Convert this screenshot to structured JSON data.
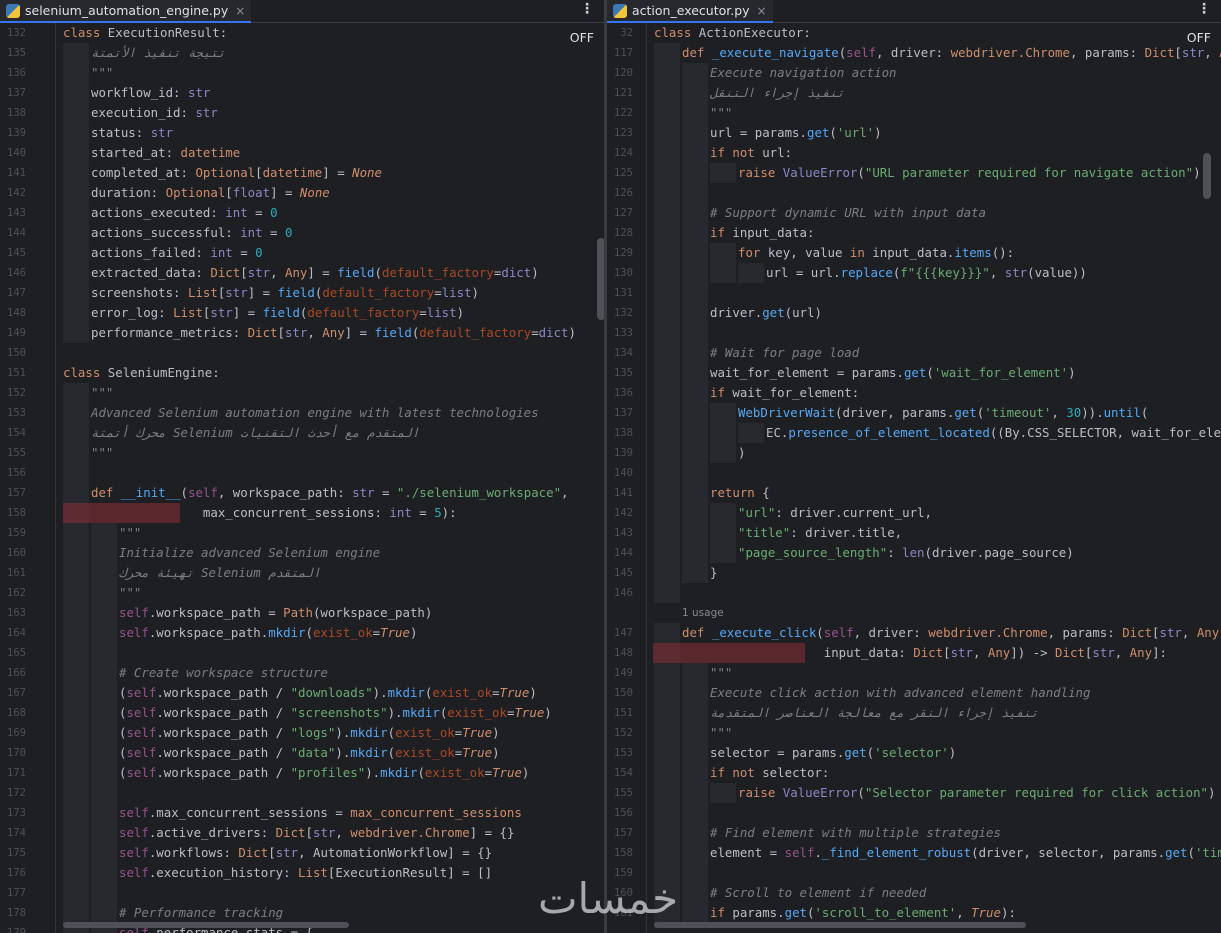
{
  "left": {
    "tab_label": "selenium_automation_engine.py",
    "tab_close": "×",
    "menu_glyph": "⋮",
    "status": "OFF",
    "lines": [
      {
        "n": "132",
        "html": "<span class='k'>class</span> <span class='cl'>ExecutionResult</span>:",
        "indent": 0
      },
      {
        "n": "135",
        "html": "<span class='c'>تتيجة تنفيذ الأتمتة</span>",
        "indent": 1
      },
      {
        "n": "136",
        "html": "<span class='c'>\"\"\"</span>",
        "indent": 1
      },
      {
        "n": "137",
        "html": "workflow_id: <span class='b'>str</span>",
        "indent": 1
      },
      {
        "n": "138",
        "html": "execution_id: <span class='b'>str</span>",
        "indent": 1
      },
      {
        "n": "139",
        "html": "status: <span class='b'>str</span>",
        "indent": 1
      },
      {
        "n": "140",
        "html": "started_at: <span class='bi'>datetime</span>",
        "indent": 1
      },
      {
        "n": "141",
        "html": "completed_at: <span class='bi'>Optional</span>[<span class='bi'>datetime</span>] = <span class='kw'>None</span>",
        "indent": 1
      },
      {
        "n": "142",
        "html": "duration: <span class='bi'>Optional</span>[<span class='b'>float</span>] = <span class='kw'>None</span>",
        "indent": 1
      },
      {
        "n": "143",
        "html": "actions_executed: <span class='b'>int</span> = <span class='n'>0</span>",
        "indent": 1
      },
      {
        "n": "144",
        "html": "actions_successful: <span class='b'>int</span> = <span class='n'>0</span>",
        "indent": 1
      },
      {
        "n": "145",
        "html": "actions_failed: <span class='b'>int</span> = <span class='n'>0</span>",
        "indent": 1
      },
      {
        "n": "146",
        "html": "extracted_data: <span class='bi'>Dict</span>[<span class='b'>str</span>, <span class='bi'>Any</span>] = <span class='f'>field</span>(<span class='p'>default_factory</span>=<span class='b'>dict</span>)",
        "indent": 1
      },
      {
        "n": "147",
        "html": "screenshots: <span class='bi'>List</span>[<span class='b'>str</span>] = <span class='f'>field</span>(<span class='p'>default_factory</span>=<span class='b'>list</span>)",
        "indent": 1
      },
      {
        "n": "148",
        "html": "error_log: <span class='bi'>List</span>[<span class='b'>str</span>] = <span class='f'>field</span>(<span class='p'>default_factory</span>=<span class='b'>list</span>)",
        "indent": 1
      },
      {
        "n": "149",
        "html": "performance_metrics: <span class='bi'>Dict</span>[<span class='b'>str</span>, <span class='bi'>Any</span>] = <span class='f'>field</span>(<span class='p'>default_factory</span>=<span class='b'>dict</span>)",
        "indent": 1
      },
      {
        "n": "150",
        "html": "",
        "indent": 0
      },
      {
        "n": "151",
        "html": "<span class='k'>class</span> <span class='cl'>SeleniumEngine</span>:",
        "indent": 0
      },
      {
        "n": "152",
        "html": "<span class='c'>\"\"\"</span>",
        "indent": 1
      },
      {
        "n": "153",
        "html": "<span class='c'>Advanced Selenium automation engine with latest technologies</span>",
        "indent": 1
      },
      {
        "n": "154",
        "html": "<span class='c'>محرك أتمتة Selenium المتقدم مع أحدث التقنيات</span>",
        "indent": 1
      },
      {
        "n": "155",
        "html": "<span class='c'>\"\"\"</span>",
        "indent": 1
      },
      {
        "n": "156",
        "html": "",
        "indent": 1
      },
      {
        "n": "157",
        "html": "<span class='k'>def</span> <span class='f'>__init__</span>(<span class='sf'>self</span>, workspace_path: <span class='b'>str</span> = <span class='s'>\"./selenium_workspace\"</span>,",
        "indent": 1
      },
      {
        "n": "158",
        "html": "               max_concurrent_sessions: <span class='b'>int</span> = <span class='n'>5</span>):",
        "indent": 1,
        "hl": [
          63,
          180
        ]
      },
      {
        "n": "159",
        "html": "<span class='c'>\"\"\"</span>",
        "indent": 2
      },
      {
        "n": "160",
        "html": "<span class='c'>Initialize advanced Selenium engine</span>",
        "indent": 2
      },
      {
        "n": "161",
        "html": "<span class='c'>تهيئة محرك Selenium المتقدم</span>",
        "indent": 2
      },
      {
        "n": "162",
        "html": "<span class='c'>\"\"\"</span>",
        "indent": 2
      },
      {
        "n": "163",
        "html": "<span class='sf'>self</span>.workspace_path = <span class='bi'>Path</span>(workspace_path)",
        "indent": 2
      },
      {
        "n": "164",
        "html": "<span class='sf'>self</span>.workspace_path.<span class='f'>mkdir</span>(<span class='p'>exist_ok</span>=<span class='kw'>True</span>)",
        "indent": 2
      },
      {
        "n": "165",
        "html": "",
        "indent": 2
      },
      {
        "n": "166",
        "html": "<span class='c'># Create workspace structure</span>",
        "indent": 2
      },
      {
        "n": "167",
        "html": "(<span class='sf'>self</span>.workspace_path / <span class='s'>\"downloads\"</span>).<span class='f'>mkdir</span>(<span class='p'>exist_ok</span>=<span class='kw'>True</span>)",
        "indent": 2
      },
      {
        "n": "168",
        "html": "(<span class='sf'>self</span>.workspace_path / <span class='s'>\"screenshots\"</span>).<span class='f'>mkdir</span>(<span class='p'>exist_ok</span>=<span class='kw'>True</span>)",
        "indent": 2
      },
      {
        "n": "169",
        "html": "(<span class='sf'>self</span>.workspace_path / <span class='s'>\"logs\"</span>).<span class='f'>mkdir</span>(<span class='p'>exist_ok</span>=<span class='kw'>True</span>)",
        "indent": 2
      },
      {
        "n": "170",
        "html": "(<span class='sf'>self</span>.workspace_path / <span class='s'>\"data\"</span>).<span class='f'>mkdir</span>(<span class='p'>exist_ok</span>=<span class='kw'>True</span>)",
        "indent": 2
      },
      {
        "n": "171",
        "html": "(<span class='sf'>self</span>.workspace_path / <span class='s'>\"profiles\"</span>).<span class='f'>mkdir</span>(<span class='p'>exist_ok</span>=<span class='kw'>True</span>)",
        "indent": 2
      },
      {
        "n": "172",
        "html": "",
        "indent": 2
      },
      {
        "n": "173",
        "html": "<span class='sf'>self</span>.max_concurrent_sessions = <span class='bi'>max_concurrent_sessions</span>",
        "indent": 2
      },
      {
        "n": "174",
        "html": "<span class='sf'>self</span>.active_drivers: <span class='bi'>Dict</span>[<span class='b'>str</span>, <span class='bi'>webdriver.Chrome</span>] = {}",
        "indent": 2
      },
      {
        "n": "175",
        "html": "<span class='sf'>self</span>.workflows: <span class='bi'>Dict</span>[<span class='b'>str</span>, <span class='cl'>AutomationWorkflow</span>] = {}",
        "indent": 2
      },
      {
        "n": "176",
        "html": "<span class='sf'>self</span>.execution_history: <span class='bi'>List</span>[<span class='cl'>ExecutionResult</span>] = []",
        "indent": 2
      },
      {
        "n": "177",
        "html": "",
        "indent": 2
      },
      {
        "n": "178",
        "html": "<span class='c'># Performance tracking</span>",
        "indent": 2
      },
      {
        "n": "179",
        "html": "<span class='sf'>self</span>.performance_stats = {",
        "indent": 2
      }
    ]
  },
  "right": {
    "tab_label": "action_executor.py",
    "tab_close": "×",
    "menu_glyph": "⋮",
    "status": "OFF",
    "usage_label": "1 usage",
    "lines": [
      {
        "n": "32",
        "html": "<span class='k'>class</span> <span class='cl'>ActionExecutor</span>:",
        "indent": 0
      },
      {
        "n": "117",
        "html": "<span class='k'>def</span> <span class='f'>_execute_navigate</span>(<span class='sf'>self</span>, driver: <span class='bi'>webdriver.Chrome</span>, params: <span class='bi'>Dict</span>[<span class='b'>str</span>, <span class='bi'>Any</span>]",
        "indent": 1
      },
      {
        "n": "120",
        "html": "<span class='c'>Execute navigation action</span>",
        "indent": 2
      },
      {
        "n": "121",
        "html": "<span class='c'>تنفيذ إجراء التنقل</span>",
        "indent": 2
      },
      {
        "n": "122",
        "html": "<span class='c'>\"\"\"</span>",
        "indent": 2
      },
      {
        "n": "123",
        "html": "url = params.<span class='f'>get</span>(<span class='s'>'url'</span>)",
        "indent": 2
      },
      {
        "n": "124",
        "html": "<span class='k'>if not</span> url:",
        "indent": 2
      },
      {
        "n": "125",
        "html": "<span class='k'>raise</span> <span class='b'>ValueError</span>(<span class='s'>\"URL parameter required for navigate action\"</span>)",
        "indent": 3
      },
      {
        "n": "126",
        "html": "",
        "indent": 2
      },
      {
        "n": "127",
        "html": "<span class='c'># Support dynamic URL with input data</span>",
        "indent": 2
      },
      {
        "n": "128",
        "html": "<span class='k'>if</span> input_data:",
        "indent": 2
      },
      {
        "n": "129",
        "html": "<span class='k'>for</span> key, value <span class='k'>in</span> input_data.<span class='f'>items</span>():",
        "indent": 3
      },
      {
        "n": "130",
        "html": "url = url.<span class='f'>replace</span>(<span class='s'>f\"{{{key}}}\"</span>, <span class='b'>str</span>(value))",
        "indent": 4
      },
      {
        "n": "131",
        "html": "",
        "indent": 2
      },
      {
        "n": "132",
        "html": "driver.<span class='f'>get</span>(url)",
        "indent": 2
      },
      {
        "n": "133",
        "html": "",
        "indent": 2
      },
      {
        "n": "134",
        "html": "<span class='c'># Wait for page load</span>",
        "indent": 2
      },
      {
        "n": "135",
        "html": "wait_for_element = params.<span class='f'>get</span>(<span class='s'>'wait_for_element'</span>)",
        "indent": 2
      },
      {
        "n": "136",
        "html": "<span class='k'>if</span> wait_for_element:",
        "indent": 2
      },
      {
        "n": "137",
        "html": "<span class='f'>WebDriverWait</span>(driver, params.<span class='f'>get</span>(<span class='s'>'timeout'</span>, <span class='n'>30</span>)).<span class='f'>until</span>(",
        "indent": 3
      },
      {
        "n": "138",
        "html": "EC.<span class='f'>presence_of_element_located</span>((By.CSS_SELECTOR, wait_for_elemen",
        "indent": 4
      },
      {
        "n": "139",
        "html": ")",
        "indent": 3
      },
      {
        "n": "140",
        "html": "",
        "indent": 2
      },
      {
        "n": "141",
        "html": "<span class='k'>return</span> {",
        "indent": 2
      },
      {
        "n": "142",
        "html": "<span class='s'>\"url\"</span>: driver.current_url,",
        "indent": 3
      },
      {
        "n": "143",
        "html": "<span class='s'>\"title\"</span>: driver.title,",
        "indent": 3
      },
      {
        "n": "144",
        "html": "<span class='s'>\"page_source_length\"</span>: <span class='b'>len</span>(driver.page_source)",
        "indent": 3
      },
      {
        "n": "145",
        "html": "}",
        "indent": 2
      },
      {
        "n": "146",
        "html": "",
        "indent": 1
      },
      {
        "n": "147",
        "html": "<span class='k'>def</span> <span class='f'>_execute_click</span>(<span class='sf'>self</span>, driver: <span class='bi'>webdriver.Chrome</span>, params: <span class='bi'>Dict</span>[<span class='b'>str</span>, <span class='bi'>Any</span>],",
        "indent": 1,
        "usage": true
      },
      {
        "n": "148",
        "html": "                   input_data: <span class='bi'>Dict</span>[<span class='b'>str</span>, <span class='bi'>Any</span>]) -> <span class='bi'>Dict</span>[<span class='b'>str</span>, <span class='bi'>Any</span>]:",
        "indent": 1,
        "hl": [
          46,
          198
        ]
      },
      {
        "n": "149",
        "html": "<span class='c'>\"\"\"</span>",
        "indent": 2
      },
      {
        "n": "150",
        "html": "<span class='c'>Execute click action with advanced element handling</span>",
        "indent": 2
      },
      {
        "n": "151",
        "html": "<span class='c'>تنفيذ إجراء النقر مع معالجة العناصر المتقدمة</span>",
        "indent": 2
      },
      {
        "n": "152",
        "html": "<span class='c'>\"\"\"</span>",
        "indent": 2
      },
      {
        "n": "153",
        "html": "selector = params.<span class='f'>get</span>(<span class='s'>'selector'</span>)",
        "indent": 2
      },
      {
        "n": "154",
        "html": "<span class='k'>if not</span> selector:",
        "indent": 2
      },
      {
        "n": "155",
        "html": "<span class='k'>raise</span> <span class='b'>ValueError</span>(<span class='s'>\"Selector parameter required for click action\"</span>)",
        "indent": 3
      },
      {
        "n": "156",
        "html": "",
        "indent": 2
      },
      {
        "n": "157",
        "html": "<span class='c'># Find element with multiple strategies</span>",
        "indent": 2
      },
      {
        "n": "158",
        "html": "element = <span class='sf'>self</span>.<span class='f'>_find_element_robust</span>(driver, selector, params.<span class='f'>get</span>(<span class='s'>'timeou</span>",
        "indent": 2
      },
      {
        "n": "159",
        "html": "",
        "indent": 2
      },
      {
        "n": "160",
        "html": "<span class='c'># Scroll to element if needed</span>",
        "indent": 2
      },
      {
        "n": "161",
        "html": "<span class='k'>if</span> params.<span class='f'>get</span>(<span class='s'>'scroll_to_element'</span>, <span class='kw'>True</span>):",
        "indent": 2
      }
    ]
  },
  "watermark": "خمسات"
}
